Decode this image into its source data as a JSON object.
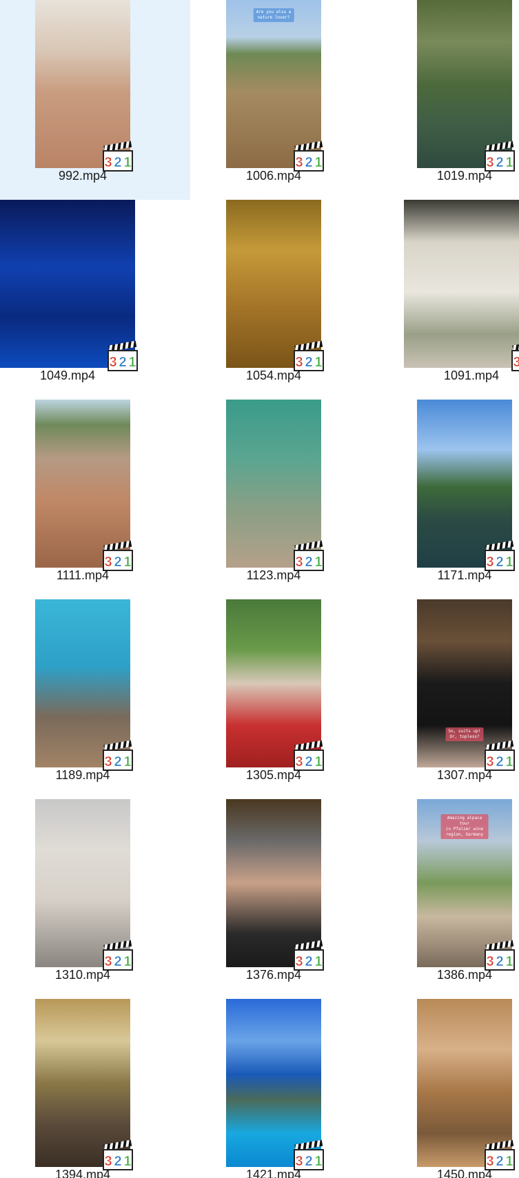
{
  "view": {
    "selected_index": 0
  },
  "files": [
    {
      "name": "992.mp4",
      "icon": "face-portrait-thumbnail",
      "orientation": "portrait",
      "bg": "linear-gradient(180deg,#e8e2da 0%,#d9c7b6 30%,#c99c80 55%,#b98366 100%)",
      "caption": ""
    },
    {
      "name": "1006.mp4",
      "icon": "meadow-thumbnail",
      "orientation": "portrait",
      "bg": "linear-gradient(180deg,#9ec2e8 0%,#b8d0e6 22%,#6e8a55 32%,#a58b62 55%,#8c6b45 100%)",
      "caption": "Are you also a\nnature lover?"
    },
    {
      "name": "1019.mp4",
      "icon": "waterfall-thumbnail",
      "orientation": "portrait",
      "bg": "linear-gradient(180deg,#566a3a 0%,#7a8a5a 25%,#4d6a3d 50%,#3f5d45 75%,#2f4a3f 100%)",
      "caption": ""
    },
    {
      "name": "1049.mp4",
      "icon": "light-tunnel-thumbnail",
      "orientation": "landscape",
      "bg": "linear-gradient(180deg,#0a1a5a 0%,#1040b0 40%,#0a2a80 70%,#0d4bbd 100%)",
      "caption": ""
    },
    {
      "name": "1054.mp4",
      "icon": "window-thumbnail",
      "orientation": "portrait",
      "bg": "linear-gradient(180deg,#8a6a20 0%,#c59a3a 30%,#a8782a 60%,#7a5418 100%)",
      "caption": ""
    },
    {
      "name": "1091.mp4",
      "icon": "villa-thumbnail",
      "orientation": "landscape",
      "bg": "linear-gradient(180deg,#3a3a34 0%,#d8d4c8 25%,#e9e6de 55%,#9aa088 80%,#c8c2b4 100%)",
      "caption": ""
    },
    {
      "name": "1111.mp4",
      "icon": "beach-selfie-thumbnail",
      "orientation": "portrait",
      "bg": "linear-gradient(180deg,#bcd4e0 0%,#6f8a5a 15%,#b59a84 35%,#c08866 60%,#9a6648 100%)",
      "caption": ""
    },
    {
      "name": "1123.mp4",
      "icon": "underwater-fish-thumbnail",
      "orientation": "portrait",
      "bg": "linear-gradient(180deg,#3a9b8a 0%,#5aa590 35%,#8a9f86 65%,#b5a08a 100%)",
      "caption": ""
    },
    {
      "name": "1171.mp4",
      "icon": "lake-boat-thumbnail",
      "orientation": "portrait",
      "bg": "linear-gradient(180deg,#4a8ad8 0%,#9cc4ee 30%,#3e6a3a 52%,#2b4a44 72%,#1f3f46 100%)",
      "caption": ""
    },
    {
      "name": "1189.mp4",
      "icon": "aquarium-tunnel-thumbnail",
      "orientation": "portrait",
      "bg": "linear-gradient(180deg,#3ab6d8 0%,#2ea0c8 40%,#7a6a5a 70%,#a28366 100%)",
      "caption": ""
    },
    {
      "name": "1305.mp4",
      "icon": "masked-selfie-thumbnail",
      "orientation": "portrait",
      "bg": "linear-gradient(180deg,#4a7a3a 0%,#6a9a4a 30%,#d8c8b8 50%,#c83030 75%,#a02020 100%)",
      "caption": ""
    },
    {
      "name": "1307.mp4",
      "icon": "tuxedo-dinner-thumbnail",
      "orientation": "portrait",
      "bg": "linear-gradient(180deg,#4a3a2a 0%,#6a5038 25%,#1a1a1a 50%,#141414 75%,#c0a898 100%)",
      "caption": "So, suits up!\nOr, topless?"
    },
    {
      "name": "1310.mp4",
      "icon": "mirror-selfie-thumbnail",
      "orientation": "portrait",
      "bg": "linear-gradient(180deg,#c8c8c8 0%,#e0dcd6 30%,#d6d0c8 60%,#8a8580 100%)",
      "caption": ""
    },
    {
      "name": "1376.mp4",
      "icon": "balloon-selfie-thumbnail",
      "orientation": "portrait",
      "bg": "linear-gradient(180deg,#4a3820 0%,#6a6a6a 25%,#c8a088 50%,#2a2a2a 80%,#1a1a1a 100%)",
      "caption": ""
    },
    {
      "name": "1386.mp4",
      "icon": "alpaca-tour-thumbnail",
      "orientation": "portrait",
      "bg": "linear-gradient(180deg,#7aa8d8 0%,#b8c8d8 25%,#7a9a5a 50%,#c8b8a0 70%,#7a6a5a 100%)",
      "caption": "Amazing alpaca tour\nin Pfalzer wine\nregion, Germany"
    },
    {
      "name": "1394.mp4",
      "icon": "palace-interior-thumbnail",
      "orientation": "portrait",
      "bg": "linear-gradient(180deg,#b89858 0%,#d8c898 25%,#8a7848 50%,#5a4a3a 75%,#3a2e24 100%)",
      "caption": ""
    },
    {
      "name": "1421.mp4",
      "icon": "coastline-thumbnail",
      "orientation": "portrait",
      "bg": "linear-gradient(180deg,#2a6ad8 0%,#6aa4e8 25%,#1a5ab8 45%,#4a6a5a 60%,#18a8e0 80%,#0a88d0 100%)",
      "caption": ""
    },
    {
      "name": "1450.mp4",
      "icon": "cloister-arches-thumbnail",
      "orientation": "portrait",
      "bg": "linear-gradient(180deg,#b88a58 0%,#d8b088 30%,#a87848 55%,#7a5a3a 80%,#c89a6a 100%)",
      "caption": ""
    }
  ],
  "badge": {
    "label": "321",
    "icon": "media-player-classic-badge-icon",
    "digit_colors": [
      "#d93a2a",
      "#2a7ac8",
      "#3aa83a"
    ]
  },
  "colors": {
    "selection": "#e5f1fb",
    "text": "#1a1a1a"
  }
}
